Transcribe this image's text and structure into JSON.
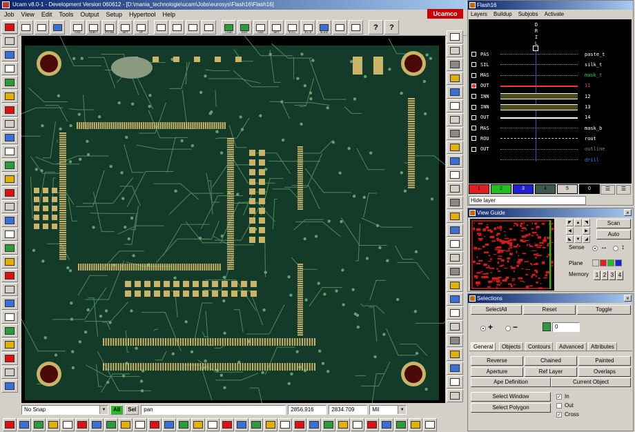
{
  "app": {
    "title": "Ucam v8.0-1 - Development Version 060612 - [D:\\mania_technologie\\ucam\\Jobs\\eurosys\\Flash16\\Flash16]",
    "brand": "Ucamco",
    "menu": [
      "Job",
      "View",
      "Edit",
      "Tools",
      "Output",
      "Setup",
      "Hypertool",
      "Help"
    ]
  },
  "toolbar": {
    "buttons": [
      {
        "name": "stop",
        "label": ""
      },
      {
        "name": "new-job",
        "label": ""
      },
      {
        "name": "open-job",
        "label": ""
      },
      {
        "name": "layers",
        "label": ""
      },
      {
        "name": "import-cad",
        "label": "CAD"
      },
      {
        "name": "import-odb",
        "label": "ODB++"
      },
      {
        "name": "import-ipc",
        "label": "IPC356"
      },
      {
        "name": "import-net",
        "label": "NET"
      },
      {
        "name": "import-vf",
        "label": "VF"
      },
      {
        "name": "save",
        "label": ""
      },
      {
        "name": "save-as",
        "label": ""
      },
      {
        "name": "print",
        "label": ""
      },
      {
        "name": "plot",
        "label": ""
      },
      {
        "name": "load",
        "label": "LOAD"
      },
      {
        "name": "edit",
        "label": "EDIT"
      },
      {
        "name": "cad-out",
        "label": "CAD"
      },
      {
        "name": "net",
        "label": "NET"
      },
      {
        "name": "ecl",
        "label": "E.C.L"
      },
      {
        "name": "ecl2",
        "label": "E.L.E"
      },
      {
        "name": "slice",
        "label": "SLICE"
      },
      {
        "name": "view",
        "label": ""
      },
      {
        "name": "show",
        "label": ""
      },
      {
        "name": "help",
        "label": "?"
      },
      {
        "name": "context-help",
        "label": "?"
      }
    ]
  },
  "status": {
    "snap": "No Snap",
    "all_label": "All",
    "sel_label": "Sel",
    "mode": "pan",
    "x": "2856.916",
    "y": "2834.709",
    "units": "Mil"
  },
  "layers_panel": {
    "title": "Flash16",
    "menu": [
      "Layers",
      "Buildup",
      "Subjobs",
      "Activate"
    ],
    "drill_label": "D R I L",
    "rows": [
      {
        "type": "PAS",
        "name": "paste_t",
        "color": "#ffffff"
      },
      {
        "type": "SIL",
        "name": "silk_t",
        "color": "#ffffff"
      },
      {
        "type": "MAS",
        "name": "mask_t",
        "color": "#22cc55"
      },
      {
        "type": "OUT",
        "name": "11",
        "color": "#ff3333"
      },
      {
        "type": "INN",
        "name": "12",
        "color": "#ffffff"
      },
      {
        "type": "INN",
        "name": "13",
        "color": "#ffffff"
      },
      {
        "type": "OUT",
        "name": "14",
        "color": "#ffffff"
      },
      {
        "type": "MAS",
        "name": "mask_b",
        "color": "#ffffff"
      },
      {
        "type": "ROU",
        "name": "rout",
        "color": "#ffffff"
      },
      {
        "type": "OUT",
        "name": "outline",
        "color": "#888888"
      },
      {
        "type": "",
        "name": "drill",
        "color": "#4477ff"
      }
    ],
    "colors": [
      {
        "label": "1",
        "bg": "#e02020"
      },
      {
        "label": "2",
        "bg": "#20c020"
      },
      {
        "label": "3",
        "bg": "#2020d0"
      },
      {
        "label": "4",
        "bg": "#3a5a50"
      },
      {
        "label": "5",
        "bg": "#d4d0c8"
      },
      {
        "label": "0",
        "bg": "#000000"
      }
    ],
    "hide_layer": "Hide layer"
  },
  "view_guide": {
    "title": "View Guide",
    "scan": "Scan",
    "auto": "Auto",
    "sense": "Sense",
    "plane": "Plane",
    "memory": "Memory",
    "memory_slots": [
      "1",
      "2",
      "3",
      "4"
    ]
  },
  "selections": {
    "title": "Selections",
    "select_all": "SelectAll",
    "reset": "Reset",
    "toggle": "Toggle",
    "count": "0",
    "tabs": [
      "General",
      "Objects",
      "Contours",
      "Advanced",
      "Attributes"
    ],
    "actions": [
      "Reverse",
      "Chained",
      "Painted",
      "Aperture",
      "Ref Layer",
      "Overlaps",
      "Ape Definition",
      "Current Object"
    ],
    "select_window": "Select Window",
    "select_polygon": "Select Polygon",
    "in_label": "In",
    "out_label": "Out",
    "cross_label": "Cross"
  }
}
